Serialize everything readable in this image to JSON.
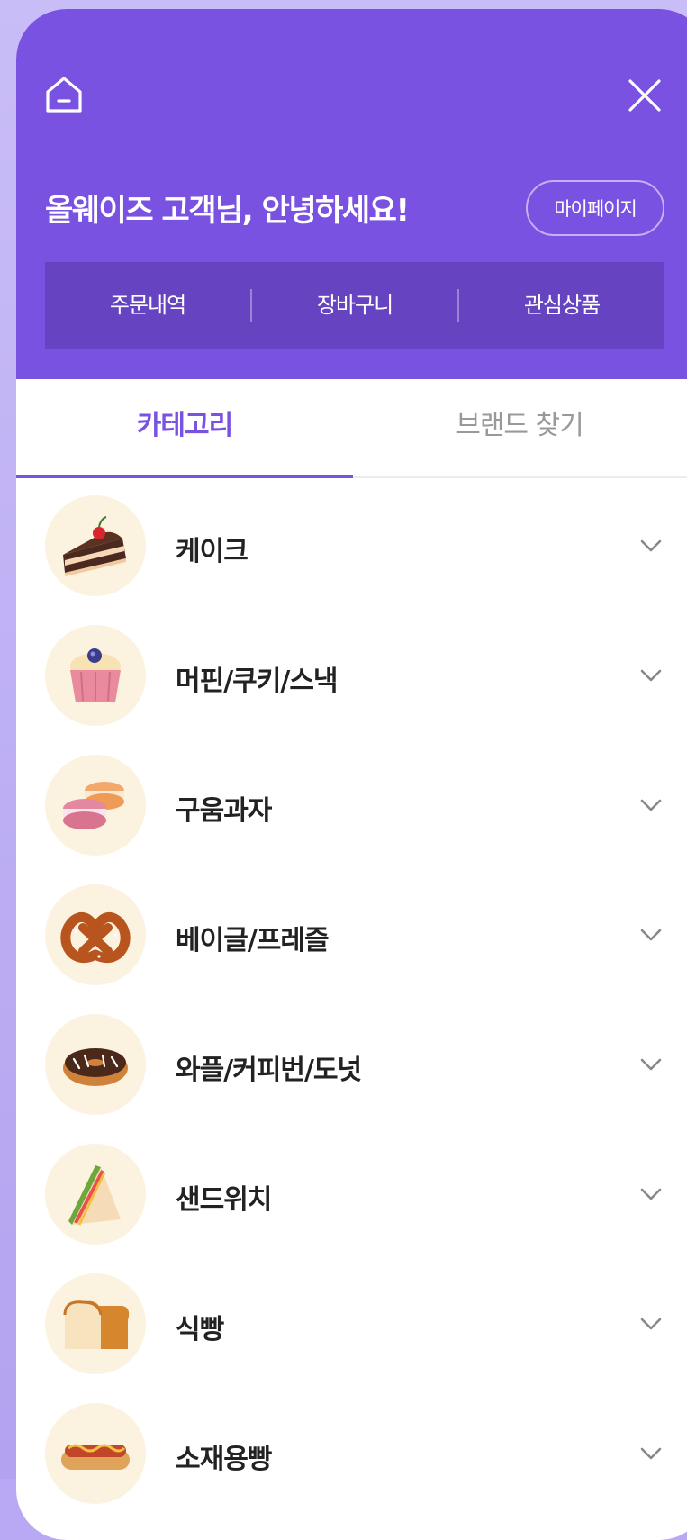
{
  "header": {
    "greeting": "올웨이즈 고객님, 안녕하세요!",
    "mypage_label": "마이페이지",
    "home_icon": "home-icon",
    "close_icon": "close-icon",
    "background_color": "#7a52e2"
  },
  "quick_menu": [
    {
      "label": "주문내역"
    },
    {
      "label": "장바구니"
    },
    {
      "label": "관심상품"
    }
  ],
  "tabs": [
    {
      "label": "카테고리",
      "active": true
    },
    {
      "label": "브랜드 찾기",
      "active": false
    }
  ],
  "categories": [
    {
      "label": "케이크",
      "icon": "cake-slice-icon"
    },
    {
      "label": "머핀/쿠키/스낵",
      "icon": "cupcake-icon"
    },
    {
      "label": "구움과자",
      "icon": "macaron-icon"
    },
    {
      "label": "베이글/프레즐",
      "icon": "pretzel-icon"
    },
    {
      "label": "와플/커피번/도넛",
      "icon": "donut-icon"
    },
    {
      "label": "샌드위치",
      "icon": "sandwich-icon"
    },
    {
      "label": "식빵",
      "icon": "bread-loaf-icon"
    },
    {
      "label": "소재용빵",
      "icon": "hotdog-icon"
    }
  ]
}
